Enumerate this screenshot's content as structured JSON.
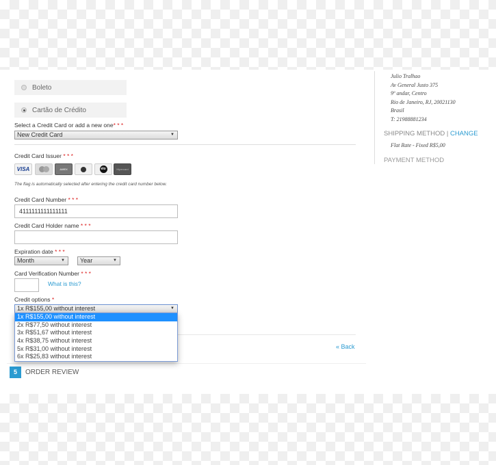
{
  "payment": {
    "options": [
      {
        "label": "Boleto",
        "selected": false
      },
      {
        "label": "Cartão de Crédito",
        "selected": true
      }
    ],
    "select_card_label": "Select a Credit Card or add a new one",
    "select_card_value": "New Credit Card",
    "issuer_label": "Credit Card Issuer",
    "issuers": [
      "VISA",
      "Mastercard",
      "American Express",
      "Diners Club",
      "elo",
      "Hipercard"
    ],
    "issuer_note": "The flag is automatically selected after entering the credit card number below.",
    "number_label": "Credit Card Number",
    "number_value": "4111111111111111",
    "holder_label": "Credit Card Holder name",
    "holder_value": "",
    "expiration_label": "Expiration date",
    "month_value": "Month",
    "year_value": "Year",
    "cvv_label": "Card Verification Number",
    "cvv_help": "What is this?",
    "credit_options_label": "Credit options",
    "credit_options_value": "1x R$155,00 without interest",
    "credit_options_list": [
      "1x R$155,00 without interest",
      "2x R$77,50 without interest",
      "3x R$51,67 without interest",
      "4x R$38,75 without interest",
      "5x R$31,00 without interest",
      "6x R$25,83 without interest"
    ],
    "required_marks": "* * *",
    "back_label": "« Back"
  },
  "step": {
    "number": "5",
    "label": "ORDER REVIEW"
  },
  "sidebar": {
    "address": [
      "Julio Tralhao",
      "Av General Justo 375",
      "9º andar, Centro",
      "Rio de Janeiro, RJ, 20021130",
      "Brasil",
      "T: 21988881234"
    ],
    "shipping_heading": "SHIPPING METHOD",
    "separator": "|",
    "change_label": "CHANGE",
    "shipping_value": "Flat Rate - Fixed R$5,00",
    "payment_heading": "PAYMENT METHOD"
  },
  "colors": {
    "accent": "#2b9bd1",
    "required": "#dd2222",
    "highlight": "#1e90ff"
  }
}
